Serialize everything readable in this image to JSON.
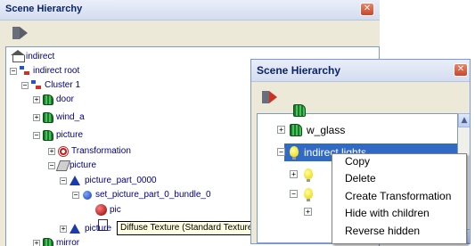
{
  "back_window": {
    "title": "Scene Hierarchy",
    "close_glyph": "✕",
    "tree": [
      {
        "label": "indirect",
        "icon": "home-icon",
        "expander": ""
      },
      {
        "label": "indirect root",
        "icon": "hierarchy-icon",
        "expander": "−"
      },
      {
        "label": "Cluster 1",
        "icon": "hierarchy-icon",
        "expander": "−"
      },
      {
        "label": "door",
        "icon": "grid-mesh-icon",
        "expander": "+"
      },
      {
        "label": "wind_a",
        "icon": "grid-mesh-icon",
        "expander": "+"
      },
      {
        "label": "picture",
        "icon": "grid-mesh-icon",
        "expander": "−"
      },
      {
        "label": "Transformation",
        "icon": "transformation-icon",
        "expander": "+"
      },
      {
        "label": "picture",
        "icon": "pen-icon",
        "expander": "−"
      },
      {
        "label": "picture_part_0000",
        "icon": "triangle-icon",
        "expander": "−"
      },
      {
        "label": "set_picture_part_0_bundle_0",
        "icon": "blue-ball-icon",
        "expander": "−"
      },
      {
        "label": "pic",
        "icon": "sphere-icon",
        "expander": ""
      },
      {
        "label": "",
        "icon": "document-icon",
        "expander": ""
      },
      {
        "label": "picture",
        "icon": "triangle-icon",
        "expander": "+"
      },
      {
        "label": "mirror",
        "icon": "grid-mesh-icon",
        "expander": "+"
      }
    ],
    "tooltip": "Diffuse Texture (Standard Texture"
  },
  "front_window": {
    "title": "Scene Hierarchy",
    "close_glyph": "✕",
    "tree": [
      {
        "label": "w_glass",
        "icon": "grid-mesh-icon",
        "expander": "+"
      },
      {
        "label": "indirect lights",
        "icon": "bulb-icon",
        "expander": "−"
      },
      {
        "label": "",
        "icon": "bulb-icon",
        "expander": "+"
      },
      {
        "label": "",
        "icon": "bulb-icon",
        "expander": "−"
      },
      {
        "label": "",
        "icon": "",
        "expander": "+"
      }
    ],
    "scroll_up_glyph": "▲",
    "scroll_down_glyph": "▼"
  },
  "context_menu": {
    "items": [
      "Copy",
      "Delete",
      "Create Transformation",
      "Hide with children",
      "Reverse hidden"
    ]
  },
  "colors": {
    "selection": "#316ac5",
    "tree_text": "#000080",
    "tooltip_bg": "#ffffe1"
  }
}
